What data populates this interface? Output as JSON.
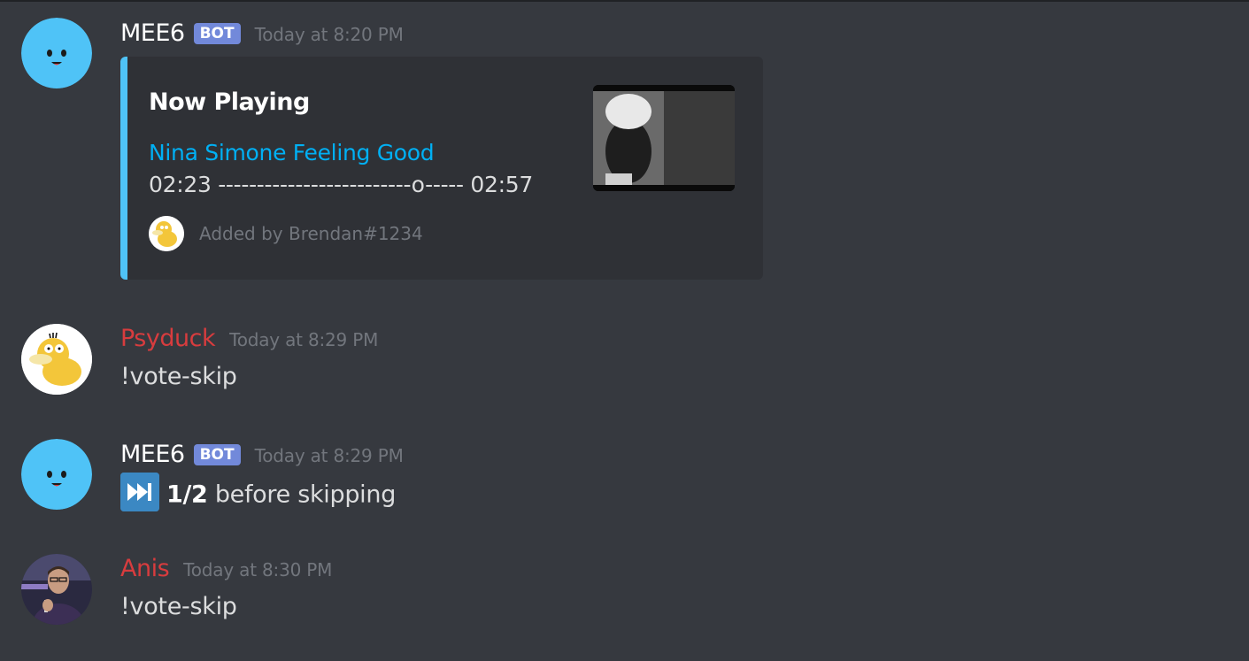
{
  "messages": [
    {
      "author": "MEE6",
      "badge": "BOT",
      "timestamp": "Today at 8:20 PM",
      "embed": {
        "title": "Now Playing",
        "link": "Nina Simone Feeling Good",
        "progress": "02:23 -------------------------o----- 02:57",
        "footer": "Added by Brendan#1234",
        "accent_color": "#4fc3f7"
      }
    },
    {
      "author": "Psyduck",
      "timestamp": "Today at 8:29 PM",
      "text": "!vote-skip"
    },
    {
      "author": "MEE6",
      "badge": "BOT",
      "timestamp": "Today at 8:29 PM",
      "emoji": "next-track-emoji",
      "bold": "1/2",
      "text": " before skipping"
    },
    {
      "author": "Anis",
      "timestamp": "Today at 8:30 PM",
      "text": "!vote-skip"
    }
  ],
  "colors": {
    "background": "#36393f",
    "embed_bg": "#2f3136",
    "bot_badge": "#7289da",
    "user_name_red": "#d83c3e",
    "link": "#00b0f4",
    "mee6_avatar": "#4fc3f7"
  }
}
